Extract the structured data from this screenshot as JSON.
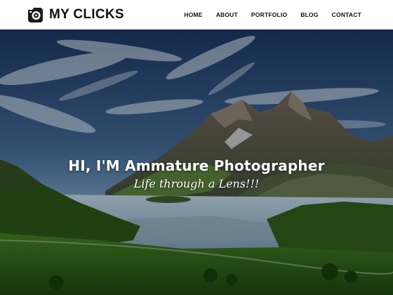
{
  "brand": {
    "name": "MY CLICKS",
    "icon": "camera-logo-icon"
  },
  "nav": {
    "items": [
      {
        "label": "HOME"
      },
      {
        "label": "ABOUT"
      },
      {
        "label": "PORTFOLIO"
      },
      {
        "label": "BLOG"
      },
      {
        "label": "CONTACT"
      }
    ]
  },
  "hero": {
    "title": "HI, I'M Ammature Photographer",
    "subtitle": "Life through a Lens!!!"
  },
  "colors": {
    "header_bg": "#ffffff",
    "nav_text": "#111111",
    "hero_text": "#ffffff"
  }
}
